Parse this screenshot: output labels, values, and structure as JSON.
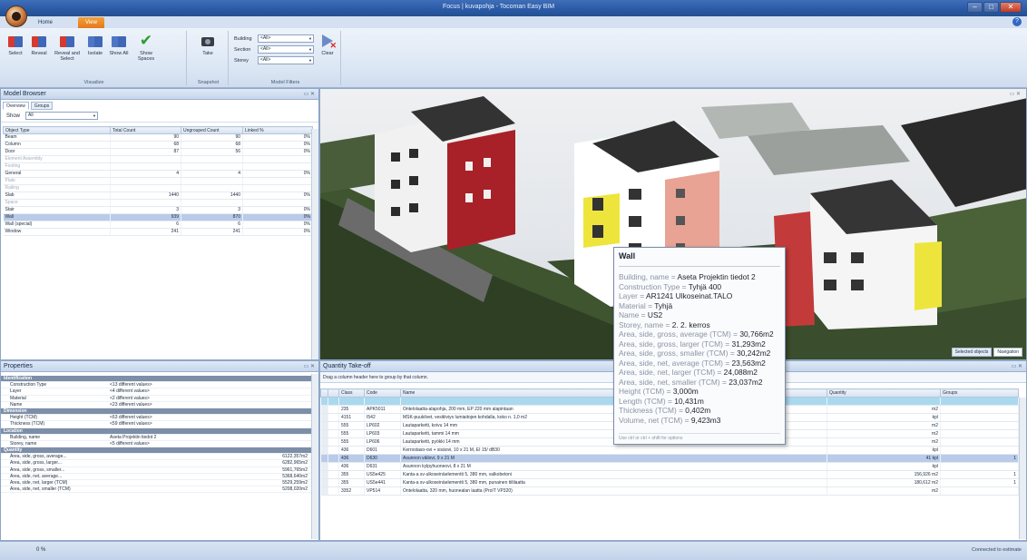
{
  "window": {
    "title": "Focus | kuvapohja - Tocoman Easy BIM"
  },
  "ribbon": {
    "tabs": [
      "Home",
      "View"
    ],
    "buttons": {
      "select": "Select",
      "reveal": "Reveal",
      "reveal_and_select": "Reveal and Select",
      "isolate": "Isolate",
      "show_all": "Show All",
      "show_spaces": "Show Spaces",
      "take_snapshot": "Take",
      "clear": "Clear"
    },
    "groups": {
      "visualize": "Visualize",
      "snapshot": "Snapshot",
      "model_filters": "Model Filters"
    },
    "filters": [
      {
        "label": "Building",
        "value": "<All>"
      },
      {
        "label": "Section",
        "value": "<All>"
      },
      {
        "label": "Storey",
        "value": "<All>"
      }
    ]
  },
  "model_browser": {
    "title": "Model Browser",
    "tabs": [
      "Overview",
      "Groups"
    ],
    "show_label": "Show",
    "show_value": "All",
    "columns": [
      "Object Type",
      "Total Count",
      "Ungrouped Count",
      "Linked %"
    ],
    "rows": [
      {
        "type": "Beam",
        "total": "90",
        "ungrouped": "90",
        "linked": "0%",
        "grey": false,
        "sel": false
      },
      {
        "type": "Column",
        "total": "68",
        "ungrouped": "68",
        "linked": "0%",
        "grey": false,
        "sel": false
      },
      {
        "type": "Door",
        "total": "87",
        "ungrouped": "56",
        "linked": "0%",
        "grey": false,
        "sel": false
      },
      {
        "type": "Element Assembly",
        "total": "",
        "ungrouped": "",
        "linked": "",
        "grey": true,
        "sel": false
      },
      {
        "type": "Footing",
        "total": "",
        "ungrouped": "",
        "linked": "",
        "grey": true,
        "sel": false
      },
      {
        "type": "General",
        "total": "4",
        "ungrouped": "4",
        "linked": "0%",
        "grey": false,
        "sel": false
      },
      {
        "type": "Plate",
        "total": "",
        "ungrouped": "",
        "linked": "",
        "grey": true,
        "sel": false
      },
      {
        "type": "Railing",
        "total": "",
        "ungrouped": "",
        "linked": "",
        "grey": true,
        "sel": false
      },
      {
        "type": "Slab",
        "total": "1440",
        "ungrouped": "1440",
        "linked": "0%",
        "grey": false,
        "sel": false
      },
      {
        "type": "Space",
        "total": "",
        "ungrouped": "",
        "linked": "",
        "grey": true,
        "sel": false
      },
      {
        "type": "Stair",
        "total": "3",
        "ungrouped": "3",
        "linked": "0%",
        "grey": false,
        "sel": false
      },
      {
        "type": "Wall",
        "total": "939",
        "ungrouped": "870",
        "linked": "0%",
        "grey": false,
        "sel": true
      },
      {
        "type": "Wall (special)",
        "total": "6",
        "ungrouped": "6",
        "linked": "0%",
        "grey": false,
        "sel": false
      },
      {
        "type": "Window",
        "total": "241",
        "ungrouped": "241",
        "linked": "0%",
        "grey": false,
        "sel": false
      }
    ]
  },
  "properties": {
    "title": "Properties",
    "rows": [
      {
        "k": "Identification",
        "v": "",
        "cat": true
      },
      {
        "k": "Construction Type",
        "v": "<13 different values>",
        "cat": false
      },
      {
        "k": "Layer",
        "v": "<4 different values>",
        "cat": false
      },
      {
        "k": "Material",
        "v": "<2 different values>",
        "cat": false
      },
      {
        "k": "Name",
        "v": "<23 different values>",
        "cat": false
      },
      {
        "k": "Dimension",
        "v": "",
        "cat": true
      },
      {
        "k": "Height (TCM)",
        "v": "<63 different values>",
        "cat": false
      },
      {
        "k": "Thickness (TCM)",
        "v": "<59 different values>",
        "cat": false
      },
      {
        "k": "Location",
        "v": "",
        "cat": true
      },
      {
        "k": "Building, name",
        "v": "Aseta Projektin tiedot 2",
        "cat": false
      },
      {
        "k": "Storey, name",
        "v": "<5 different values>",
        "cat": false
      },
      {
        "k": "Quantity",
        "v": "",
        "cat": true
      },
      {
        "k": "Area, side, gross, average...",
        "v": "6122,357m2",
        "cat": false,
        "num": true
      },
      {
        "k": "Area, side, gross, larger...",
        "v": "6282,965m2",
        "cat": false,
        "num": true
      },
      {
        "k": "Area, side, gross, smaller...",
        "v": "5961,765m2",
        "cat": false,
        "num": true
      },
      {
        "k": "Area, side, net, average...",
        "v": "5368,640m2",
        "cat": false,
        "num": true
      },
      {
        "k": "Area, side, net, larger (TCM)",
        "v": "5529,259m2",
        "cat": false,
        "num": true
      },
      {
        "k": "Area, side, net, smaller (TCM)",
        "v": "5208,020m2",
        "cat": false,
        "num": true
      }
    ]
  },
  "viewport": {
    "panel_controls": "▭ ✕",
    "tabs": [
      "Selected objects",
      "Navigation"
    ]
  },
  "tooltip": {
    "title": "Wall",
    "lines": [
      {
        "k": "Building, name",
        "v": "Aseta Projektin tiedot 2"
      },
      {
        "k": "Construction Type",
        "v": "Tyhjä 400"
      },
      {
        "k": "Layer",
        "v": "AR1241 Ulkoseinat.TALO"
      },
      {
        "k": "Material",
        "v": "Tyhjä"
      },
      {
        "k": "Name",
        "v": "US2"
      },
      {
        "k": "Storey, name",
        "v": "2. 2. kerros"
      },
      {
        "k": "Area, side, gross, average (TCM)",
        "v": "30,766m2"
      },
      {
        "k": "Area, side, gross, larger (TCM)",
        "v": "31,293m2"
      },
      {
        "k": "Area, side, gross, smaller (TCM)",
        "v": "30,242m2"
      },
      {
        "k": "Area, side, net, average (TCM)",
        "v": "23,563m2"
      },
      {
        "k": "Area, side, net, larger (TCM)",
        "v": "24,088m2"
      },
      {
        "k": "Area, side, net, smaller (TCM)",
        "v": "23,037m2"
      },
      {
        "k": "Height (TCM)",
        "v": "3,000m"
      },
      {
        "k": "Length (TCM)",
        "v": "10,431m"
      },
      {
        "k": "Thickness (TCM)",
        "v": "0,402m"
      },
      {
        "k": "Volume, net (TCM)",
        "v": "9,423m3"
      }
    ],
    "footer": "Use ctrl or ctrl + shift for options"
  },
  "qto": {
    "title": "Quantity Take-off",
    "hint": "Drag a column header here to group by that column.",
    "columns": [
      "Class",
      "Code",
      "Name",
      "Quantity",
      "Groups"
    ],
    "filter_row": [
      "",
      "",
      "",
      "",
      ""
    ],
    "rows": [
      {
        "cls": "235",
        "code": "APK5011",
        "name": "Ontelolaatta-alapohja, 200 mm, EP 220 mm alapintaan",
        "qty": "m2",
        "grp": "",
        "sel": false
      },
      {
        "cls": "4151",
        "code": "I542",
        "name": "MSK-puukilvet, vesitiiviys lumiaitojen kohdalla, koko n. 1,0 m2",
        "qty": "kpl",
        "grp": "",
        "sel": false
      },
      {
        "cls": "555",
        "code": "LP602",
        "name": "Lautaparketti, koivu 14 mm",
        "qty": "m2",
        "grp": "",
        "sel": false
      },
      {
        "cls": "555",
        "code": "LP603",
        "name": "Lautaparketti, tammi 14 mm",
        "qty": "m2",
        "grp": "",
        "sel": false
      },
      {
        "cls": "555",
        "code": "LP606",
        "name": "Lautaparketti, pyökki 14 mm",
        "qty": "m2",
        "grp": "",
        "sel": false
      },
      {
        "cls": "436",
        "code": "D601",
        "name": "Kerrostaso-ovi + sisäovi, 10 x 21 M, EI 15/ dB30",
        "qty": "kpl",
        "grp": "",
        "sel": false
      },
      {
        "cls": "436",
        "code": "D630",
        "name": "Asunnon väliovi, 9 x 21 M",
        "qty": "41 kpl",
        "grp": "1",
        "sel": true
      },
      {
        "cls": "436",
        "code": "D631",
        "name": "Asunnon kylpyhuoneovi, 8 x 21 M",
        "qty": "kpl",
        "grp": "",
        "sel": false
      },
      {
        "cls": "355",
        "code": "US5e425",
        "name": "Kanta-a sv-ulkoseinäelementti 5, 380 mm, valkobetoni",
        "qty": "156,926 m2",
        "grp": "1",
        "sel": false
      },
      {
        "cls": "355",
        "code": "US5e441",
        "name": "Kanta-a sv-ulkoseinäelementti 5, 380 mm, punainen tiililaatta",
        "qty": "180,612 m2",
        "grp": "1",
        "sel": false
      },
      {
        "cls": "3352",
        "code": "VP514",
        "name": "Ontelolaatta, 320 mm, huonealan laatta (ProIT VP320)",
        "qty": "m2",
        "grp": "",
        "sel": false
      }
    ]
  },
  "status": {
    "progress": "0 %",
    "connection": "Connected to estimate"
  }
}
